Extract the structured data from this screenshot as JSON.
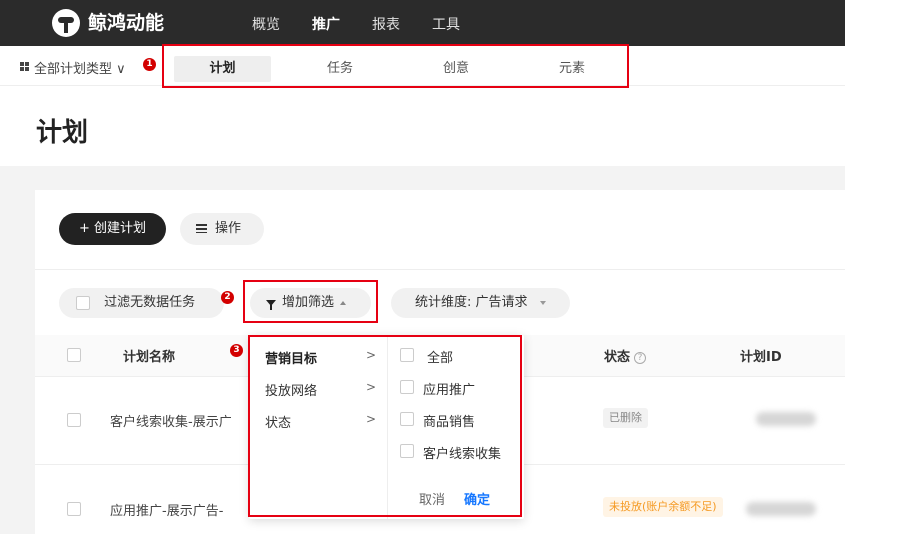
{
  "app": {
    "brand": "鲸鸿动能"
  },
  "nav": {
    "items": [
      "概览",
      "推广",
      "报表",
      "工具"
    ],
    "active_index": 1
  },
  "subbar": {
    "type_select": "全部计划类型 ∨",
    "tabs": [
      "计划",
      "任务",
      "创意",
      "元素"
    ],
    "active_index": 0
  },
  "page": {
    "title": "计划"
  },
  "toolbar": {
    "create_label": "+ 创建计划",
    "ops_label": "操作"
  },
  "filters": {
    "no_data_label": "过滤无数据任务",
    "add_filter_label": "增加筛选",
    "dimension_label": "统计维度: 广告请求"
  },
  "badges": [
    "1",
    "2",
    "3"
  ],
  "table": {
    "headers": {
      "name": "计划名称",
      "status": "状态",
      "id": "计划ID"
    },
    "help_icon": "?",
    "rows": [
      {
        "name": "客户线索收集-展示广",
        "status": "已删除"
      },
      {
        "name": "应用推广-展示广告-",
        "status": "未投放(账户余额不足)"
      }
    ]
  },
  "dropdown": {
    "categories": [
      "营销目标",
      "投放网络",
      "状态"
    ],
    "arrow": ">",
    "active_index": 0,
    "options": [
      "全部",
      "应用推广",
      "商品销售",
      "客户线索收集"
    ],
    "cancel_label": "取消",
    "confirm_label": "确定"
  },
  "colors": {
    "accent": "#1677ff",
    "annotation": "#e60012",
    "topbar": "#2b2b2b",
    "deleted_tag_bg": "#f2f2f2",
    "warn_tag_bg": "#fff4e5",
    "warn_tag_text": "#f59a23"
  }
}
